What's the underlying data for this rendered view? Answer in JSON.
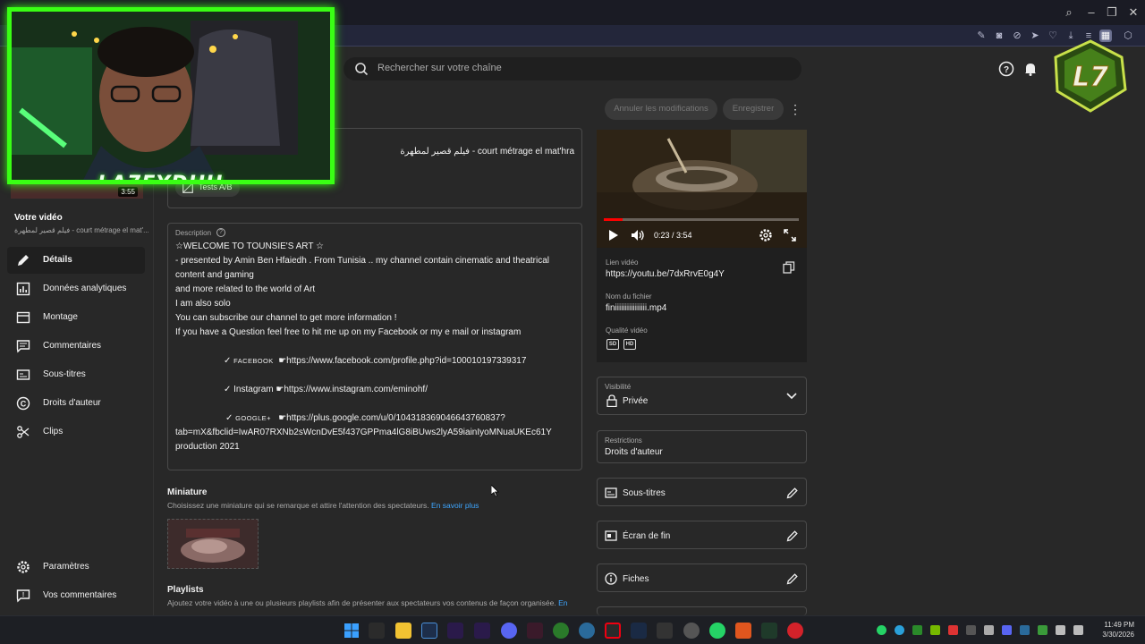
{
  "browser": {
    "title_controls": [
      "search",
      "minimize",
      "restore",
      "close"
    ]
  },
  "header": {
    "search_placeholder": "Rechercher sur votre chaîne"
  },
  "webcam": {
    "name": "LA7FYDHH"
  },
  "logo_text": "L7",
  "sidebar": {
    "duration": "3:55",
    "your_video_label": "Votre vidéo",
    "video_subtitle": "فيلم قصير لمطهرة - court métrage el mat'...",
    "items": [
      {
        "label": "Détails",
        "icon": "pencil-icon",
        "active": true
      },
      {
        "label": "Données analytiques",
        "icon": "analytics-icon",
        "active": false
      },
      {
        "label": "Montage",
        "icon": "editor-icon",
        "active": false
      },
      {
        "label": "Commentaires",
        "icon": "comments-icon",
        "active": false
      },
      {
        "label": "Sous-titres",
        "icon": "subtitles-icon",
        "active": false
      },
      {
        "label": "Droits d'auteur",
        "icon": "copyright-icon",
        "active": false
      },
      {
        "label": "Clips",
        "icon": "scissors-icon",
        "active": false
      }
    ],
    "bottom_items": [
      {
        "label": "Paramètres",
        "icon": "gear-icon"
      },
      {
        "label": "Vos commentaires",
        "icon": "feedback-icon"
      }
    ]
  },
  "details": {
    "title_value": "فيلم قصير لمطهرة - court métrage el mat'hra",
    "ab_test_label": "Tests A/B",
    "description_label": "Description",
    "description_lines": [
      "☆WELCOME TO TOUNSIE'S ART ☆",
      " - presented by Amin Ben Hfaiedh . From Tunisia .. my channel contain cinematic and theatrical",
      "content and gaming",
      "and more related to the world of Art",
      "I am also solo",
      "You can subscribe our channel to get more information !",
      "If you have a Question feel free to hit me up on my Facebook or my e mail or instagram"
    ],
    "facebook_prefix": "✓",
    "facebook_name": "FACEBOOK",
    "facebook_link": "☛https://www.facebook.com/profile.php?id=100010197339317",
    "instagram_line": "✓ Instagram ☛https://www.instagram.com/eminohf/",
    "google_prefix": "✓",
    "google_name": "GOOGLE+",
    "google_link": "☛https://plus.google.com/u/0/104318369046643760837?",
    "google_link_cont": "tab=mX&fbclid=IwAR07RXNb2sWcnDvE5f437GPPma4lG8iBUws2lyA59iainIyoMNuaUKEc61Y",
    "production": "production 2021"
  },
  "thumbnail": {
    "title": "Miniature",
    "subtitle": "Choisissez une miniature qui se remarque et attire l'attention des spectateurs.",
    "learn_more": "En savoir plus"
  },
  "playlists": {
    "title": "Playlists",
    "subtitle": "Ajoutez votre vidéo à une ou plusieurs playlists afin de présenter aux spectateurs vos contenus de façon organisée.",
    "learn_more": "En"
  },
  "actions": {
    "cancel": "Annuler les modifications",
    "save": "Enregistrer"
  },
  "player": {
    "time": "0:23 / 3:54",
    "progress": 0.098
  },
  "video_info": {
    "link_label": "Lien vidéo",
    "link_value": "https://youtu.be/7dxRrvE0g4Y",
    "filename_label": "Nom du fichier",
    "filename_value": "finiiiiiiiiiiiiiiii.mp4",
    "quality_label": "Qualité vidéo",
    "quality_badges": [
      "SD",
      "HD"
    ]
  },
  "visibility": {
    "label": "Visibilité",
    "value": "Privée"
  },
  "restrictions": {
    "label": "Restrictions",
    "value": "Droits d'auteur"
  },
  "cards": [
    {
      "label": "Sous-titres",
      "icon": "subtitles-icon"
    },
    {
      "label": "Écran de fin",
      "icon": "end-screen-icon"
    },
    {
      "label": "Fiches",
      "icon": "info-icon"
    }
  ],
  "taskbar": {
    "time": "11:49 PM",
    "date": "3/30/2026"
  },
  "colors": {
    "accent_link": "#3ea6ff",
    "webcam_frame": "#39ff14",
    "progress": "#ff0000"
  }
}
